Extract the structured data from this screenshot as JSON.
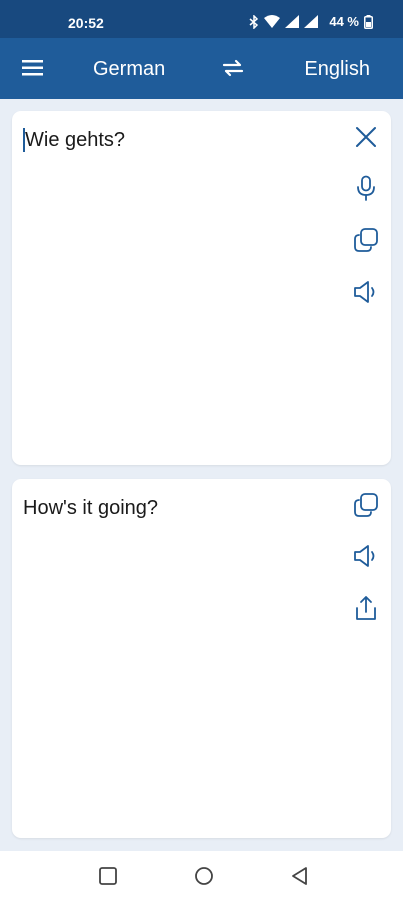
{
  "status_bar": {
    "time": "20:52",
    "battery": "44 %",
    "icons": [
      "bluetooth-icon",
      "wifi-icon",
      "signal-icon",
      "signal-icon",
      "battery-icon"
    ]
  },
  "app_bar": {
    "source_language": "German",
    "target_language": "English",
    "menu_icon": "menu-icon",
    "swap_icon": "swap-icon"
  },
  "input_card": {
    "text": "Wie gehts?",
    "actions": [
      "close-icon",
      "microphone-icon",
      "copy-icon",
      "speaker-icon"
    ]
  },
  "output_card": {
    "text": "How's it going?",
    "actions": [
      "copy-icon",
      "speaker-icon",
      "share-icon"
    ]
  },
  "nav_bar": {
    "buttons": [
      "recents-icon",
      "home-icon",
      "back-icon"
    ]
  },
  "colors": {
    "status_bar": "#18497f",
    "app_bar": "#1f5c9a",
    "background": "#e8eef6",
    "icon": "#1f5c9a"
  }
}
